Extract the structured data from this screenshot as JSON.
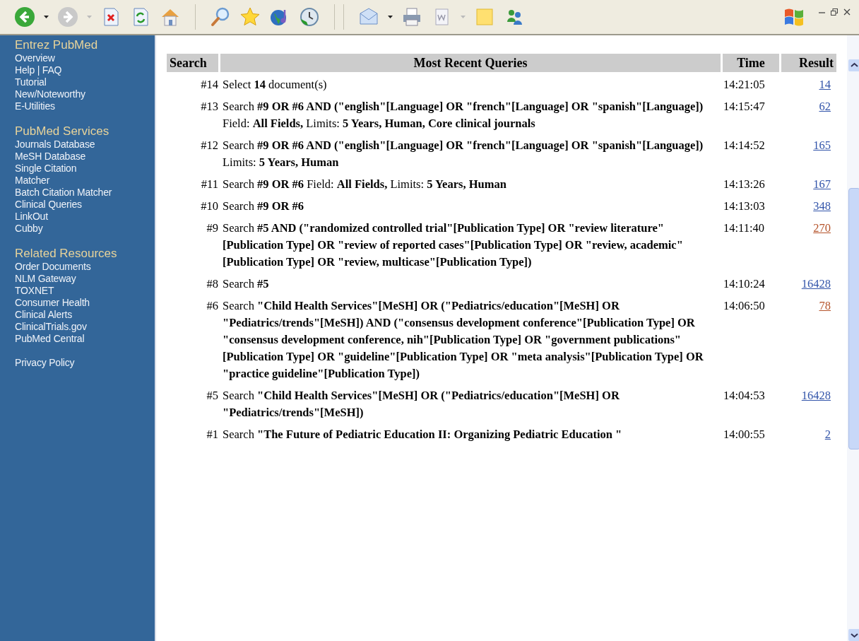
{
  "sidebar": {
    "sections": [
      {
        "header": "Entrez PubMed",
        "items": [
          "Overview",
          "Help | FAQ",
          "Tutorial",
          "New/Noteworthy",
          "E-Utilities"
        ]
      },
      {
        "header": "PubMed Services",
        "items": [
          "Journals Database",
          "MeSH Database",
          "Single Citation",
          "Matcher",
          "Batch Citation Matcher",
          "Clinical Queries",
          "LinkOut",
          "Cubby"
        ]
      },
      {
        "header": "Related Resources",
        "items": [
          "Order Documents",
          "NLM Gateway",
          "TOXNET",
          "Consumer Health",
          "Clinical Alerts",
          "ClinicalTrials.gov",
          "PubMed Central"
        ]
      },
      {
        "items": [
          "Privacy Policy"
        ]
      }
    ]
  },
  "table": {
    "columns": [
      "Search",
      "Most Recent Queries",
      "Time",
      "Result"
    ],
    "rows": [
      {
        "number": "#14",
        "query": "Select **14** document(s)",
        "time": "14:21:05",
        "result": "14",
        "visited": false
      },
      {
        "number": "#13",
        "query": "Search **#9 OR #6 AND (\"english\"[Language] OR \"french\"[Language] OR \"spanish\"[Language])** Field: **All Fields,** Limits: **5 Years, Human, Core clinical journals**",
        "time": "14:15:47",
        "result": "62",
        "visited": false
      },
      {
        "number": "#12",
        "query": "Search **#9 OR #6 AND (\"english\"[Language] OR \"french\"[Language] OR \"spanish\"[Language])** Limits: **5 Years, Human**",
        "time": "14:14:52",
        "result": "165",
        "visited": false
      },
      {
        "number": "#11",
        "query": "Search **#9 OR #6** Field: **All Fields,** Limits: **5 Years, Human**",
        "time": "14:13:26",
        "result": "167",
        "visited": false
      },
      {
        "number": "#10",
        "query": "Search **#9 OR #6**",
        "time": "14:13:03",
        "result": "348",
        "visited": false
      },
      {
        "number": "#9",
        "query": "Search **#5 AND (\"randomized controlled trial\"[Publication Type] OR \"review literature\"[Publication Type] OR \"review of reported cases\"[Publication Type] OR \"review, academic\"[Publication Type] OR \"review, multicase\"[Publication Type])**",
        "time": "14:11:40",
        "result": "270",
        "visited": true
      },
      {
        "number": "#8",
        "query": "Search **#5**",
        "time": "14:10:24",
        "result": "16428",
        "visited": false
      },
      {
        "number": "#6",
        "query": "Search **\"Child Health Services\"[MeSH] OR (\"Pediatrics/education\"[MeSH] OR \"Pediatrics/trends\"[MeSH]) AND (\"consensus development conference\"[Publication Type] OR \"consensus development conference, nih\"[Publication Type] OR \"government publications\"[Publication Type] OR \"guideline\"[Publication Type] OR \"meta analysis\"[Publication Type] OR \"practice guideline\"[Publication Type])**",
        "time": "14:06:50",
        "result": "78",
        "visited": true
      },
      {
        "number": "#5",
        "query": "Search **\"Child Health Services\"[MeSH] OR (\"Pediatrics/education\"[MeSH] OR \"Pediatrics/trends\"[MeSH])**",
        "time": "14:04:53",
        "result": "16428",
        "visited": false
      },
      {
        "number": "#1",
        "query": "Search **\"The Future of Pediatric Education II: Organizing Pediatric Education \"**",
        "time": "14:00:55",
        "result": "2",
        "visited": false
      }
    ]
  }
}
